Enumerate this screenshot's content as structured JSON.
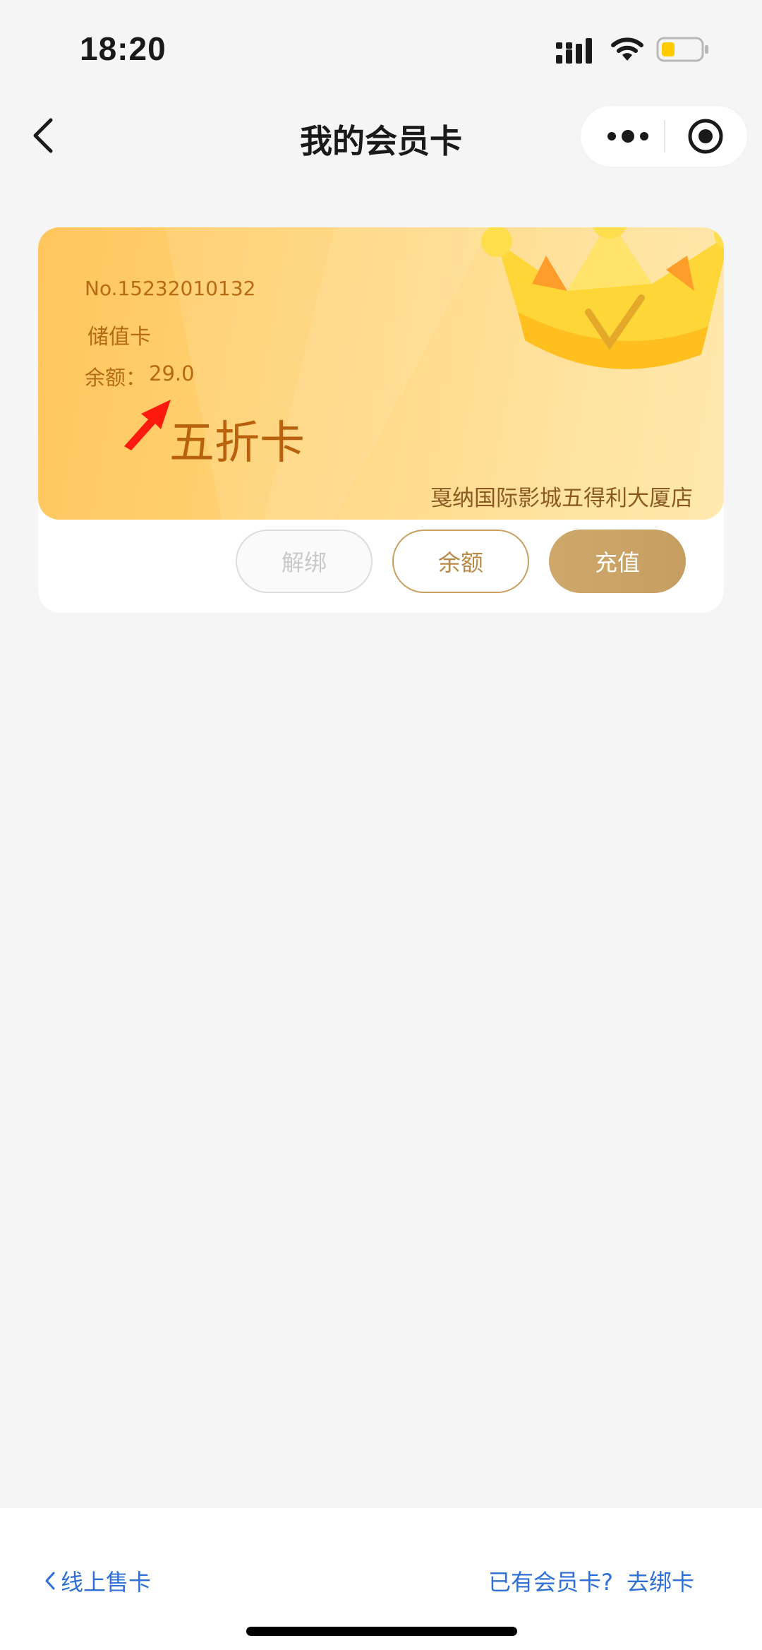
{
  "status_bar": {
    "time": "18:20"
  },
  "nav": {
    "title": "我的会员卡",
    "back_icon": "chevron-left-icon",
    "more_icon": "more-dots-icon",
    "target_icon": "record-target-icon"
  },
  "card": {
    "number": "No.15232010132",
    "type": "储值卡",
    "balance_label": "余额：",
    "balance_value": "29.0",
    "annotation": "五折卡",
    "store": "戛纳国际影城五得利大厦店",
    "colors": {
      "card_start": "#ffc65c",
      "card_end": "#ffe7a6",
      "text": "#b56a13",
      "gold": "#c69e62"
    }
  },
  "actions": {
    "unbind": "解绑",
    "balance": "余额",
    "recharge": "充值"
  },
  "bottom": {
    "sell_cards": "线上售卡",
    "have_card": "已有会员卡?",
    "go_bind": "去绑卡",
    "link_color": "#2f6fd6"
  }
}
